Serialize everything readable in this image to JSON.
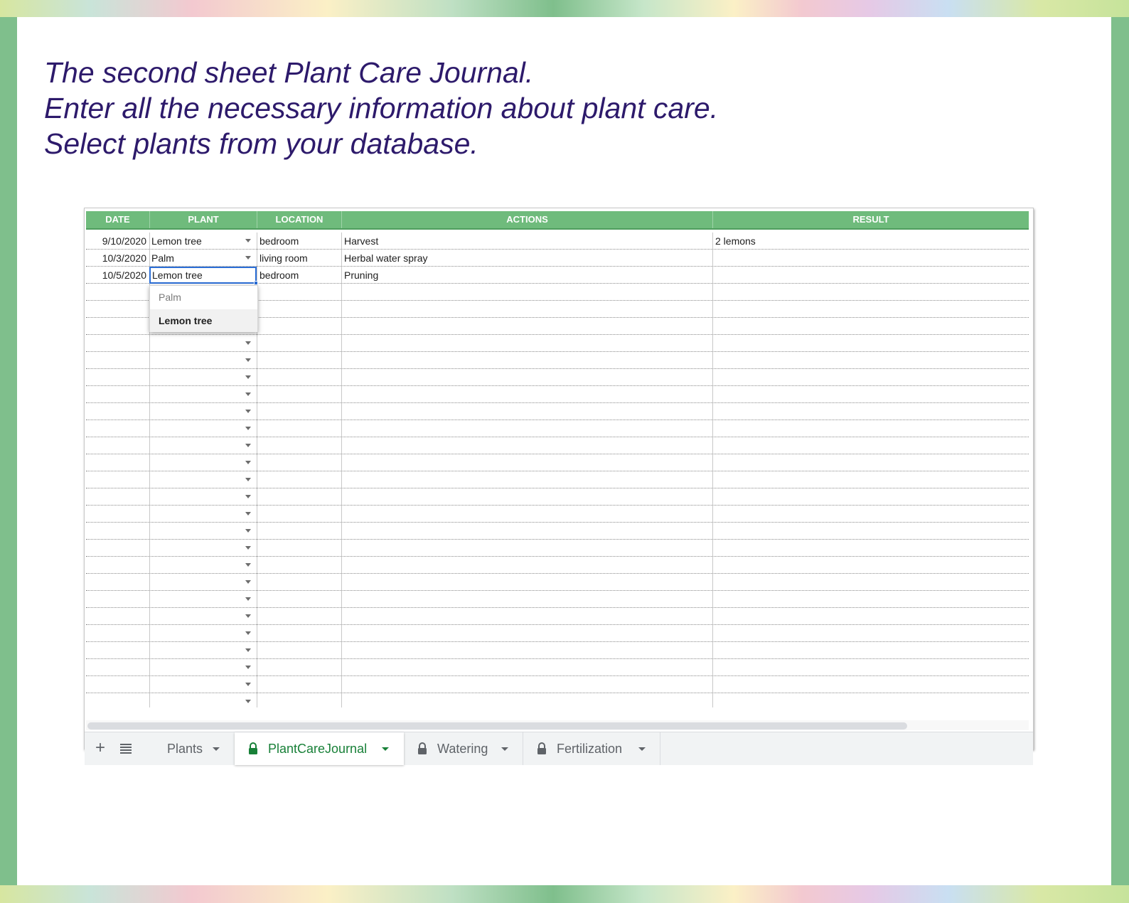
{
  "intro": {
    "line1": "The second sheet Plant Care Journal.",
    "line2": "Enter all the necessary information about plant care.",
    "line3": "Select plants from your database."
  },
  "columns": [
    "DATE",
    "PLANT",
    "LOCATION",
    "ACTIONS",
    "RESULT"
  ],
  "rows": [
    {
      "date": "9/10/2020",
      "plant": "Lemon tree",
      "location": "bedroom",
      "actions": "Harvest",
      "result": "2 lemons"
    },
    {
      "date": "10/3/2020",
      "plant": "Palm",
      "location": "living room",
      "actions": "Herbal water spray",
      "result": ""
    },
    {
      "date": "10/5/2020",
      "plant": "Lemon tree",
      "location": "bedroom",
      "actions": "Pruning",
      "result": ""
    }
  ],
  "dropdown": {
    "options": [
      "Palm",
      "Lemon tree"
    ],
    "selected": "Lemon tree"
  },
  "tabs": [
    {
      "label": "Plants",
      "locked": false,
      "active": false
    },
    {
      "label": "PlantCareJournal",
      "locked": true,
      "active": true
    },
    {
      "label": "Watering",
      "locked": true,
      "active": false
    },
    {
      "label": "Fertilization",
      "locked": true,
      "active": false
    }
  ],
  "icons": {
    "add_sheet": "plus-icon",
    "all_sheets": "list-icon",
    "lock": "lock-icon",
    "dropdown_arrow": "chevron-down-icon"
  },
  "colors": {
    "header_green": "#6fbb7c",
    "active_tab_green": "#188038",
    "selection_blue": "#2b6ed6",
    "intro_text": "#2d1a6b"
  }
}
